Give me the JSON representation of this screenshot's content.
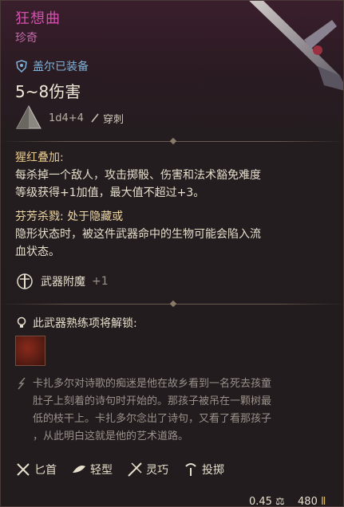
{
  "item": {
    "name": "狂想曲",
    "rarity": "珍奇",
    "equipped_by": "盖尔已装备",
    "damage": "5~8伤害",
    "dice": "1d4+4",
    "damage_type": "穿刺"
  },
  "passive": {
    "title": "猩红叠加:",
    "line1": "每杀掉一个敌人，攻击掷骰、伤害和法术豁免难度",
    "line2": "等级获得+1加值，最大值不超过+3。"
  },
  "slaying": {
    "title": "芬芳杀戮: 处于隐藏或",
    "line1": "隐形状态时，被这件武器命中的生物可能会陷入流",
    "line2": "血状态。"
  },
  "enchant": {
    "label": "武器附魔",
    "value": "+1"
  },
  "mastery": {
    "label": "此武器熟练项将解锁:"
  },
  "lore": {
    "line1": "卡扎多尔对诗歌的痴迷是他在故乡看到一名死去孩童",
    "line2": "肚子上刻着的诗句时开始的。那孩子被吊在一颗树最",
    "line3": "低的枝干上。卡扎多尔念出了诗句，又看了看那孩子",
    "line4": "，从此明白这就是他的艺术道路。"
  },
  "properties": [
    "匕首",
    "轻型",
    "灵巧",
    "投掷"
  ],
  "footer": {
    "weight": "0.45",
    "price": "480"
  },
  "colors": {
    "rarity_title": "#d64fb0",
    "equipped": "#7fb3d9",
    "highlight": "#f0d9a6"
  }
}
